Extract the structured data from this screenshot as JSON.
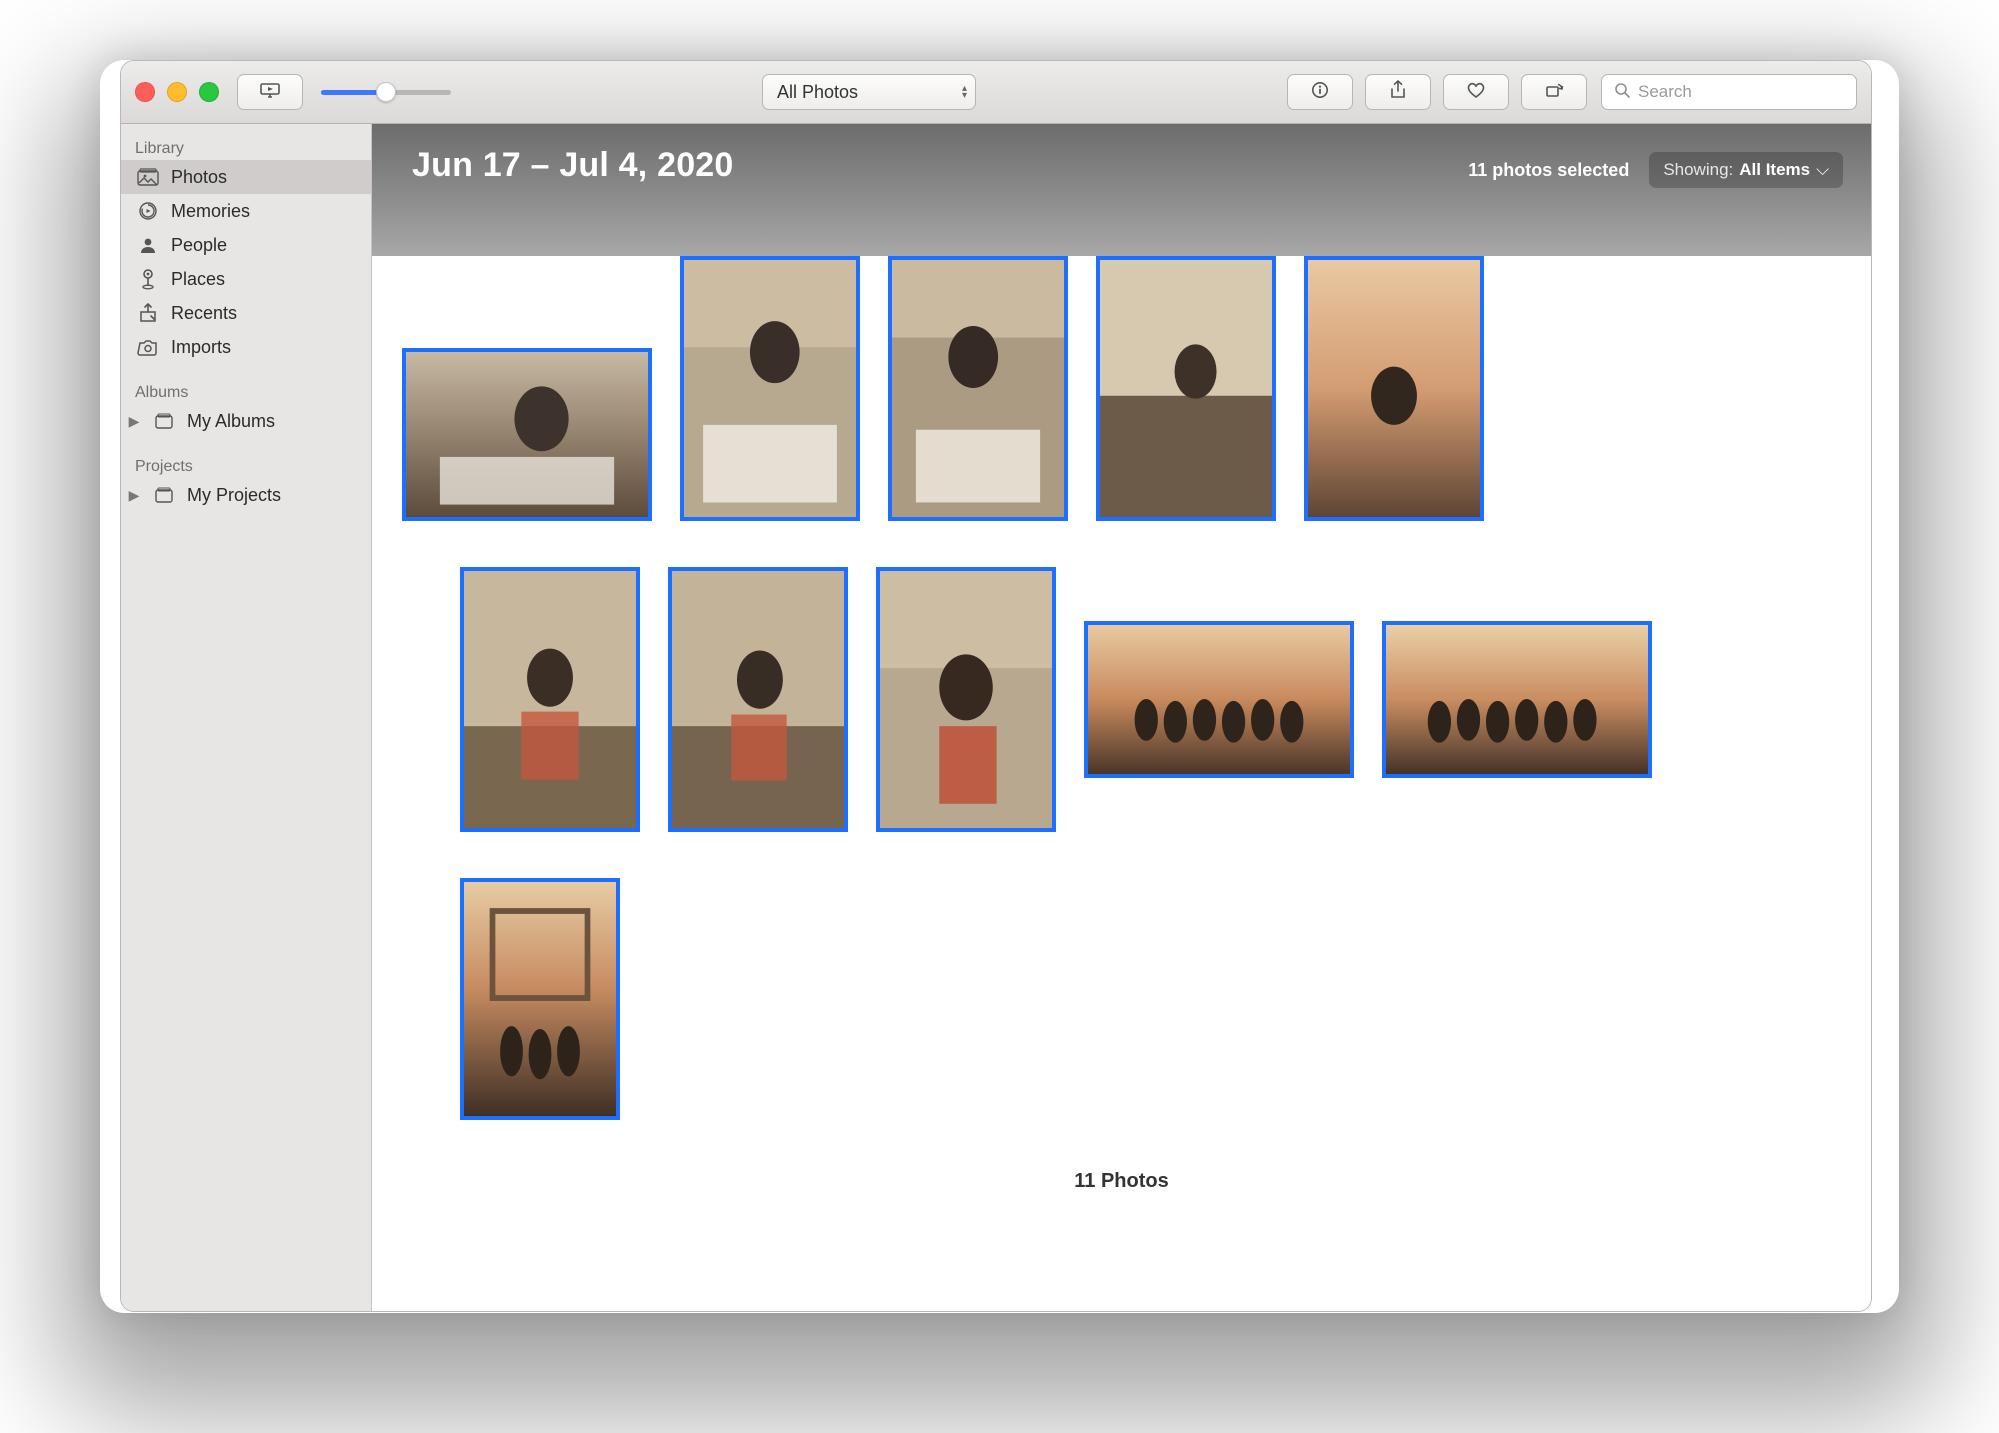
{
  "toolbar": {
    "view_mode_label": "All Photos",
    "search_placeholder": "Search"
  },
  "sidebar": {
    "sections": {
      "library": "Library",
      "albums": "Albums",
      "projects": "Projects"
    },
    "library_items": [
      {
        "label": "Photos",
        "icon": "photos"
      },
      {
        "label": "Memories",
        "icon": "memories"
      },
      {
        "label": "People",
        "icon": "people"
      },
      {
        "label": "Places",
        "icon": "places"
      },
      {
        "label": "Recents",
        "icon": "recents"
      },
      {
        "label": "Imports",
        "icon": "imports"
      }
    ],
    "albums_item": "My Albums",
    "projects_item": "My Projects"
  },
  "hero": {
    "title": "Jun 17 – Jul 4, 2020",
    "selection": "11 photos selected",
    "showing_label": "Showing:",
    "showing_value": "All Items"
  },
  "footer": {
    "count_label": "11 Photos"
  },
  "thumbs": [
    {
      "aspect": "landscape"
    },
    {
      "aspect": "portrait"
    },
    {
      "aspect": "portrait"
    },
    {
      "aspect": "portrait"
    },
    {
      "aspect": "portrait"
    },
    {
      "aspect": "portrait"
    },
    {
      "aspect": "portrait"
    },
    {
      "aspect": "portrait"
    },
    {
      "aspect": "wide"
    },
    {
      "aspect": "wide"
    },
    {
      "aspect": "portrait-sm"
    }
  ]
}
